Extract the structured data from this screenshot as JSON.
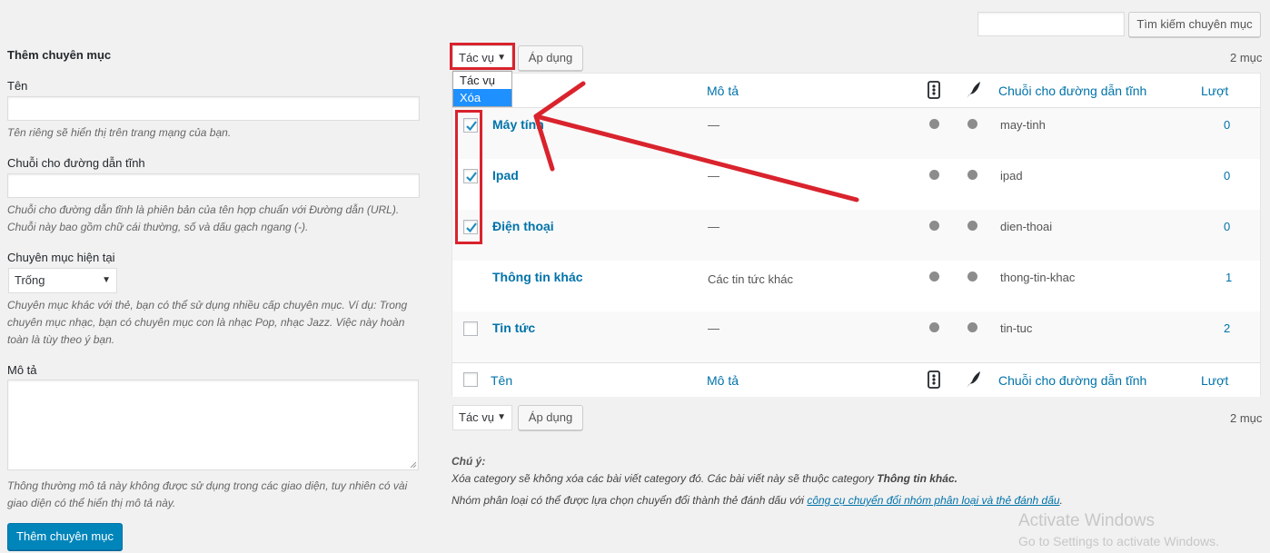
{
  "search": {
    "input_value": "",
    "button_label": "Tìm kiếm chuyên mục"
  },
  "form": {
    "title": "Thêm chuyên mục",
    "name_label": "Tên",
    "name_hint": "Tên riêng sẽ hiển thị trên trang mạng của bạn.",
    "slug_label": "Chuỗi cho đường dẫn tĩnh",
    "slug_hint_1": "Chuỗi cho đường dẫn tĩnh là phiên bản của tên hợp chuẩn với Đường dẫn (URL).",
    "slug_hint_2": "Chuỗi này bao gồm chữ cái thường, số và dấu gạch ngang (-).",
    "parent_label": "Chuyên mục hiện tại",
    "parent_selected": "Trống",
    "parent_hint_1": "Chuyên mục khác với thẻ, bạn có thể sử dụng nhiều cấp chuyên mục. Ví dụ: Trong",
    "parent_hint_2": "chuyên mục nhạc, bạn có chuyên mục con là nhạc Pop, nhạc Jazz. Việc này hoàn",
    "parent_hint_3": "toàn là tùy theo ý bạn.",
    "desc_label": "Mô tả",
    "desc_hint_1": "Thông thường mô tả này không được sử dụng trong các giao diện, tuy nhiên có vài",
    "desc_hint_2": "giao diện có thể hiển thị mô tả này.",
    "submit_label": "Thêm chuyên mục"
  },
  "bulk": {
    "selected": "Tác vụ",
    "apply_label": "Áp dụng",
    "options": [
      "Tác vụ",
      "Xóa"
    ],
    "items_count": "2 mục"
  },
  "columns": {
    "name": "Tên",
    "description": "Mô tả",
    "slug": "Chuỗi cho đường dẫn tĩnh",
    "count": "Lượt"
  },
  "rows": [
    {
      "name": "Máy tính",
      "description": "—",
      "slug": "may-tinh",
      "count": "0",
      "checked": true
    },
    {
      "name": "Ipad",
      "description": "—",
      "slug": "ipad",
      "count": "0",
      "checked": true
    },
    {
      "name": "Điện thoại",
      "description": "—",
      "slug": "dien-thoai",
      "count": "0",
      "checked": true
    },
    {
      "name": "Thông tin khác",
      "description": "Các tin tức khác",
      "slug": "thong-tin-khac",
      "count": "1",
      "checked": false
    },
    {
      "name": "Tin tức",
      "description": "—",
      "slug": "tin-tuc",
      "count": "2",
      "checked": false
    }
  ],
  "note": {
    "title": "Chú ý:",
    "line1_prefix": "Xóa category sẽ không xóa các bài viết category đó. Các bài viết này sẽ thuộc category",
    "line1_bold": "Thông tin khác.",
    "line2_prefix": "Nhóm phân loại có thể được lựa chọn chuyển đổi thành thẻ đánh dấu với",
    "line2_link": "công cụ chuyển đổi nhóm phân loại và thẻ đánh dấu",
    "line2_suffix": "."
  },
  "watermark": {
    "title": "Activate Windows",
    "subtitle": "Go to Settings to activate Windows."
  },
  "colors": {
    "link": "#0073aa",
    "primary": "#0085ba",
    "annotation": "#d9232d",
    "dropdown_highlight": "#1e90ff"
  }
}
